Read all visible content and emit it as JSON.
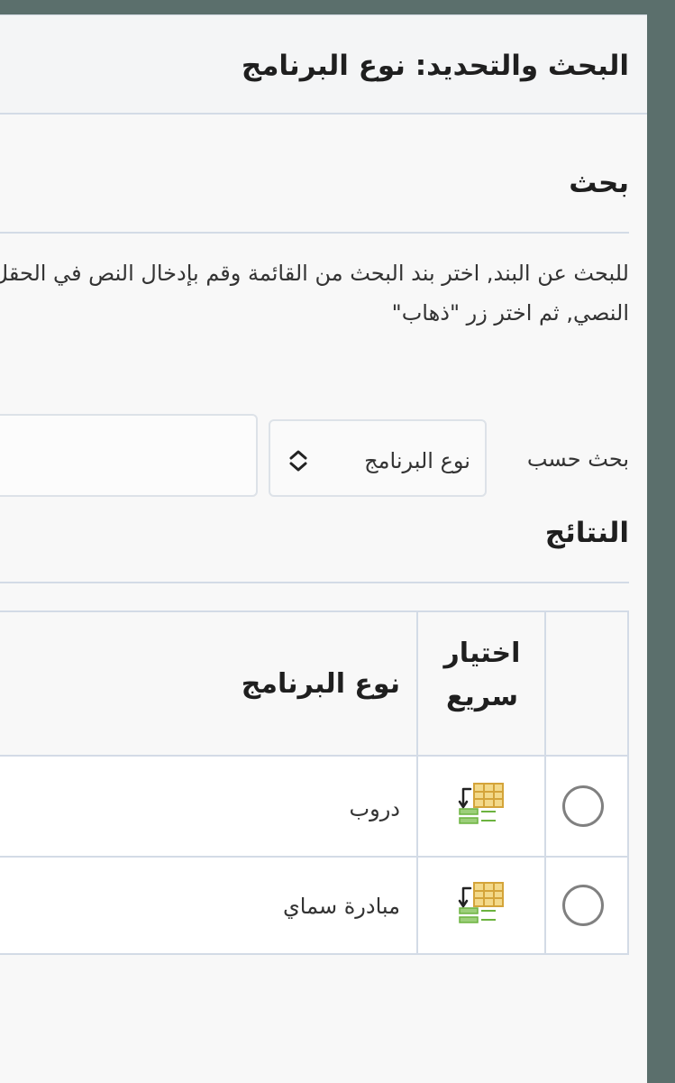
{
  "dialog": {
    "title": "البحث والتحديد: نوع البرنامج"
  },
  "search": {
    "heading": "بحث",
    "instructions": "للبحث عن البند, اختر بند البحث من القائمة وقم بإدخال النص في الحقل النصي, ثم اختر زر \"ذهاب\"",
    "search_by_label": "بحث حسب",
    "search_by_selected": "نوع البرنامج",
    "query_value": ""
  },
  "results": {
    "heading": "النتائج",
    "columns": {
      "quick_select": "اختيار سريع",
      "program_type": "نوع البرنامج"
    },
    "rows": [
      {
        "program_type": "دروب"
      },
      {
        "program_type": "مبادرة سماي"
      }
    ]
  },
  "icons": {
    "select_chevron": "chevron-up-down-icon",
    "quick_select": "quick-select-icon"
  },
  "colors": {
    "border": "#d3dbe6",
    "icon_yellow": "#e6b84a",
    "icon_green": "#6cb33f"
  }
}
